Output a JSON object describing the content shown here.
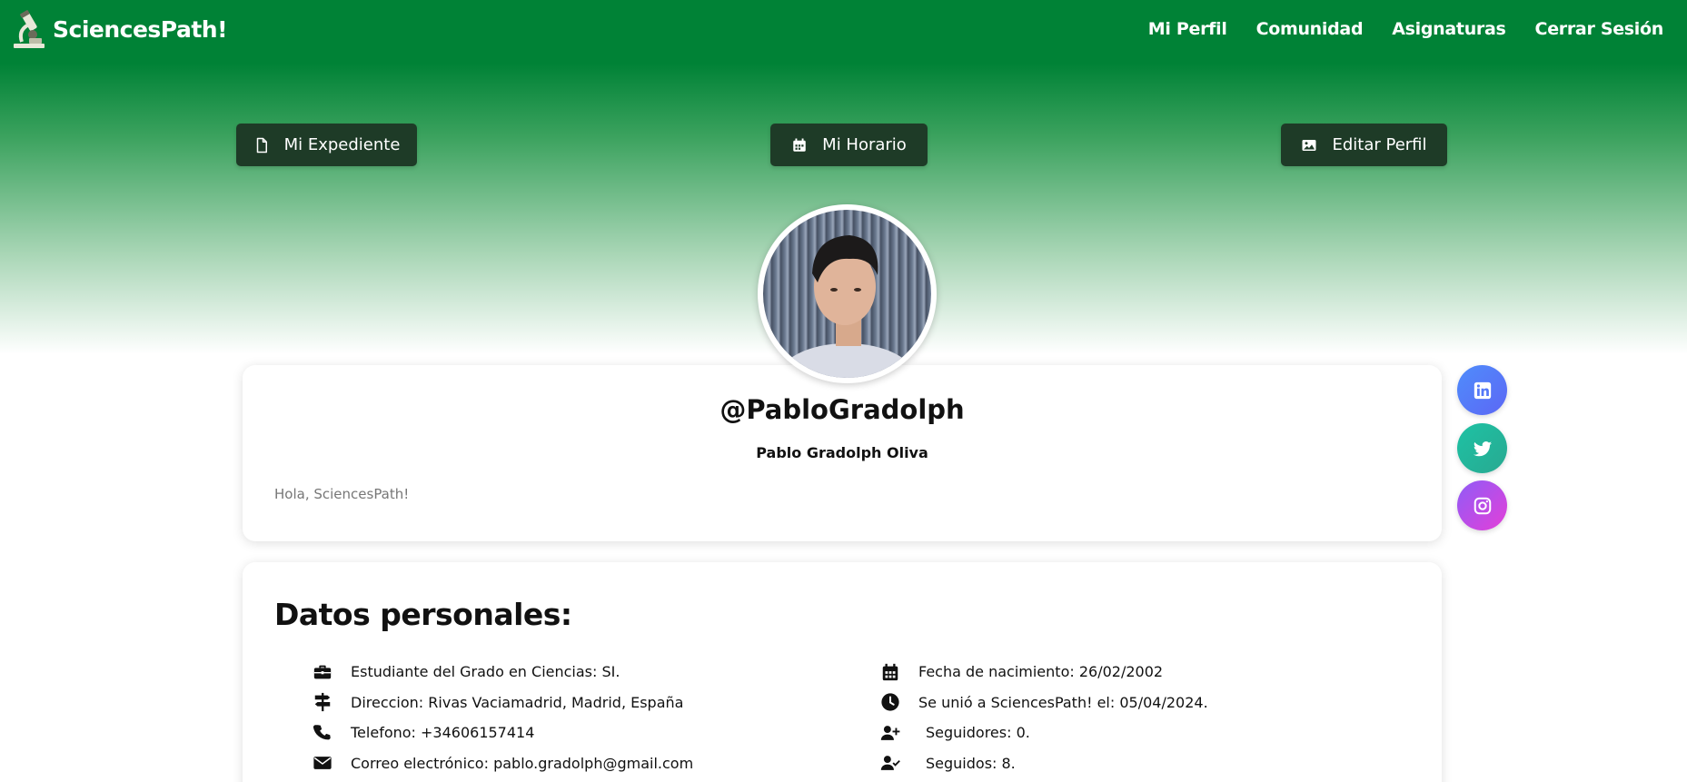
{
  "brand": {
    "name": "SciencesPath!",
    "logo_icon": "microscope-icon"
  },
  "nav": {
    "items": [
      {
        "label": "Mi Perfil"
      },
      {
        "label": "Comunidad"
      },
      {
        "label": "Asignaturas"
      },
      {
        "label": "Cerrar Sesión"
      }
    ]
  },
  "actions": {
    "expediente": {
      "label": "Mi Expediente",
      "icon": "file-icon"
    },
    "horario": {
      "label": "Mi Horario",
      "icon": "calendar-icon"
    },
    "editar": {
      "label": "Editar Perfil",
      "icon": "image-icon"
    }
  },
  "profile": {
    "username": "@PabloGradolph",
    "full_name": "Pablo Gradolph Oliva",
    "bio": "Hola, SciencesPath!"
  },
  "social": {
    "linkedin": {
      "icon": "linkedin-icon"
    },
    "twitter": {
      "icon": "twitter-icon"
    },
    "instagram": {
      "icon": "instagram-icon"
    }
  },
  "personal_data": {
    "title": "Datos personales:",
    "left": [
      {
        "icon": "briefcase-icon",
        "text": "Estudiante del Grado en Ciencias: SI."
      },
      {
        "icon": "signpost-icon",
        "text": "Direccion: Rivas Vaciamadrid, Madrid, España"
      },
      {
        "icon": "phone-icon",
        "text": "Telefono: +34606157414"
      },
      {
        "icon": "envelope-icon",
        "text": "Correo electrónico: pablo.gradolph@gmail.com"
      }
    ],
    "right": [
      {
        "icon": "calendar-icon",
        "text": "Fecha de nacimiento: 26/02/2002"
      },
      {
        "icon": "clock-icon",
        "text": "Se unió a SciencesPath! el: 05/04/2024."
      },
      {
        "icon": "user-plus-icon",
        "text": "Seguidores: 0."
      },
      {
        "icon": "user-check-icon",
        "text": "Seguidos: 8."
      }
    ]
  },
  "colors": {
    "primary_green": "#008236",
    "button_dark": "#1e3b27"
  }
}
